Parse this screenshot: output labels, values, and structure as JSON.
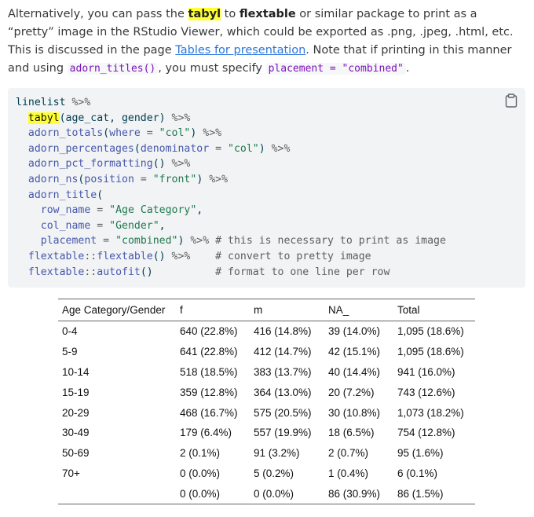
{
  "paragraph": {
    "t1": "Alternatively, you can pass the ",
    "tabyl": "tabyl",
    "t2": " to ",
    "flextable": "flextable",
    "t3": " or similar package to print as a “pretty” image in the RStudio Viewer, which could be exported as .png, .jpeg, .html, etc. This is discussed in the page ",
    "link": "Tables for presentation",
    "t4": ". Note that if printing in this manner and using ",
    "code1": "adorn_titles()",
    "t5": ", you must specify ",
    "code2": "placement = \"combined\"",
    "t6": "."
  },
  "codeblock": {
    "copy_icon": "clipboard-icon",
    "l1": [
      "linelist",
      " %>%"
    ],
    "l2": [
      "tabyl",
      "(age_cat, gender) ",
      "%>%"
    ],
    "l3": [
      "adorn_totals",
      "(",
      "where",
      " = ",
      "\"col\"",
      ") ",
      "%>%"
    ],
    "l4": [
      "adorn_percentages",
      "(",
      "denominator",
      " = ",
      "\"col\"",
      ") ",
      "%>%"
    ],
    "l5": [
      "adorn_pct_formatting",
      "() ",
      "%>%"
    ],
    "l6": [
      "adorn_ns",
      "(",
      "position",
      " = ",
      "\"front\"",
      ") ",
      "%>%"
    ],
    "l7": [
      "adorn_title",
      "("
    ],
    "l8": [
      "row_name",
      " = ",
      "\"Age Category\"",
      ","
    ],
    "l9": [
      "col_name",
      " = ",
      "\"Gender\"",
      ","
    ],
    "l10": [
      "placement",
      " = ",
      "\"combined\"",
      ") ",
      "%>%",
      " # this is necessary to print as image"
    ],
    "l11": [
      "flextable",
      "::",
      "flextable",
      "() ",
      "%>%",
      "    # convert to pretty image"
    ],
    "l12": [
      "flextable",
      "::",
      "autofit",
      "()",
      "          # format to one line per row"
    ]
  },
  "table": {
    "headers": [
      "Age Category/Gender",
      "f",
      "m",
      "NA_",
      "Total"
    ],
    "rows": [
      [
        "0-4",
        "640 (22.8%)",
        "416 (14.8%)",
        "39 (14.0%)",
        "1,095 (18.6%)"
      ],
      [
        "5-9",
        "641 (22.8%)",
        "412 (14.7%)",
        "42 (15.1%)",
        "1,095 (18.6%)"
      ],
      [
        "10-14",
        "518 (18.5%)",
        "383 (13.7%)",
        "40 (14.4%)",
        "941 (16.0%)"
      ],
      [
        "15-19",
        "359 (12.8%)",
        "364 (13.0%)",
        "20 (7.2%)",
        "743 (12.6%)"
      ],
      [
        "20-29",
        "468 (16.7%)",
        "575 (20.5%)",
        "30 (10.8%)",
        "1,073 (18.2%)"
      ],
      [
        "30-49",
        "179 (6.4%)",
        "557 (19.9%)",
        "18 (6.5%)",
        "754 (12.8%)"
      ],
      [
        "50-69",
        "2 (0.1%)",
        "91 (3.2%)",
        "2 (0.7%)",
        "95 (1.6%)"
      ],
      [
        "70+",
        "0 (0.0%)",
        "5 (0.2%)",
        "1 (0.4%)",
        "6 (0.1%)"
      ],
      [
        "",
        "0 (0.0%)",
        "0 (0.0%)",
        "86 (30.9%)",
        "86 (1.5%)"
      ]
    ]
  }
}
